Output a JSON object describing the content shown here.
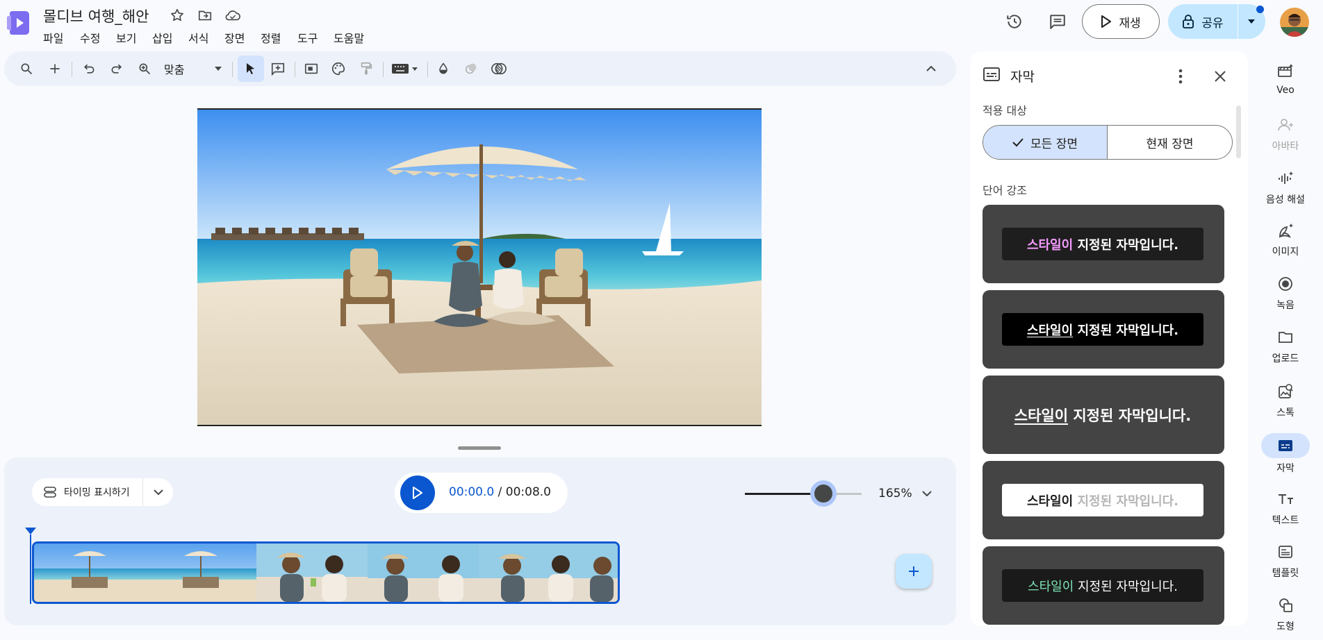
{
  "header": {
    "doc_title": "몰디브 여행_해안",
    "menu": [
      "파일",
      "수정",
      "보기",
      "삽입",
      "서식",
      "장면",
      "정렬",
      "도구",
      "도움말"
    ],
    "play_label": "재생",
    "share_label": "공유"
  },
  "toolbar": {
    "zoom_value": "맞춤",
    "icons": [
      "search-icon",
      "add-icon",
      "undo-icon",
      "redo-icon",
      "zoom-in-icon",
      "select-icon",
      "add-comment-icon",
      "background-icon",
      "theme-icon",
      "paint-format-icon",
      "keyboard-icon",
      "fill-color-icon",
      "border-color-icon",
      "effects-icon",
      "collapse-icon"
    ]
  },
  "timeline": {
    "timing_label": "타이밍 표시하기",
    "time_current": "00:00.0",
    "time_separator": " / ",
    "time_total": "00:08.0",
    "zoom_percent": "165%",
    "zoom_slider_level": 0.67
  },
  "caption_panel": {
    "title": "자막",
    "apply_label": "적용 대상",
    "seg_all": "모든 장면",
    "seg_current": "현재 장면",
    "emphasis_label": "단어 강조",
    "styles": [
      {
        "emph": "스타일이",
        "rest": " 지정된 자막입니다."
      },
      {
        "emph": "스타일이",
        "rest": " 지정된 자막입니다."
      },
      {
        "emph": "스타일이",
        "rest": " 지정된 자막입니다."
      },
      {
        "emph": "스타일이",
        "rest": " 지정된 자막입니다."
      },
      {
        "emph": "스타일이",
        "rest": " 지정된 자막입니다."
      }
    ],
    "colors": {
      "pink": "#f59cff",
      "green": "#7ee6b8",
      "grey_text": "#b5b5b5"
    }
  },
  "rail": [
    {
      "label": "Veo"
    },
    {
      "label": "아바타"
    },
    {
      "label": "음성 해설"
    },
    {
      "label": "이미지"
    },
    {
      "label": "녹음"
    },
    {
      "label": "업로드"
    },
    {
      "label": "스톡"
    },
    {
      "label": "자막"
    },
    {
      "label": "텍스트"
    },
    {
      "label": "템플릿"
    },
    {
      "label": "도형"
    }
  ],
  "accent_color": "#0b57d0"
}
